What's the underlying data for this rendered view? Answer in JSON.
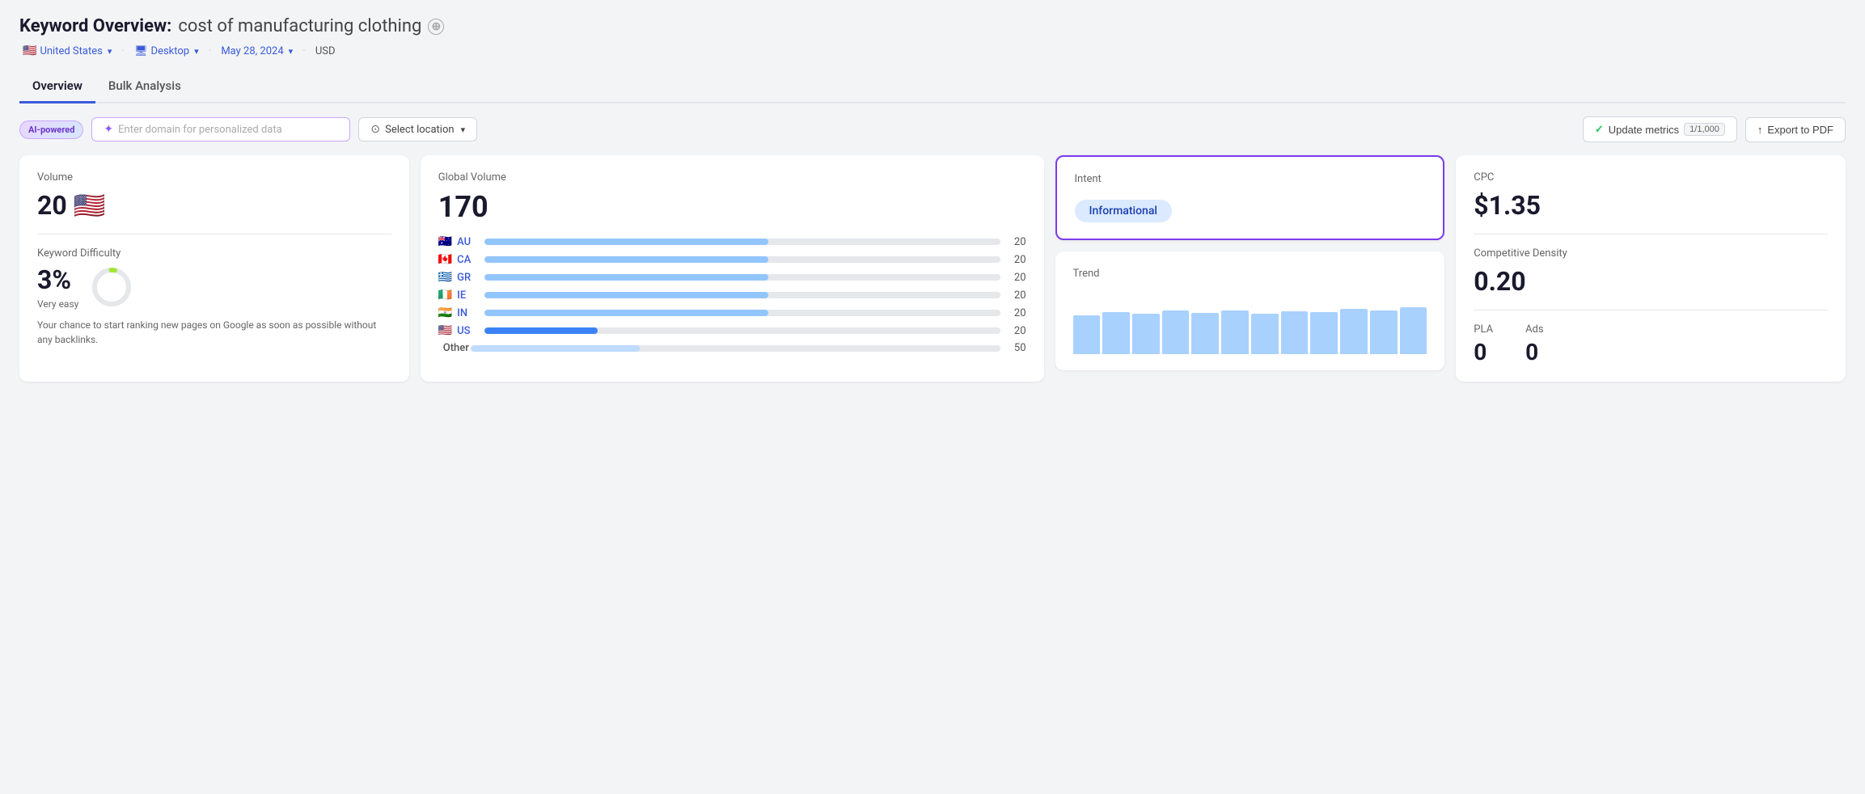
{
  "header": {
    "title_prefix": "Keyword Overview:",
    "keyword": "cost of manufacturing clothing",
    "add_icon": "⊕",
    "meta": {
      "country": "United States",
      "country_flag": "🇺🇸",
      "device": "Desktop",
      "device_icon": "🖥",
      "date": "May 28, 2024",
      "currency": "USD"
    }
  },
  "tabs": [
    {
      "label": "Overview",
      "active": true
    },
    {
      "label": "Bulk Analysis",
      "active": false
    }
  ],
  "toolbar": {
    "ai_badge": "AI-powered",
    "domain_placeholder": "Enter domain for personalized data",
    "location_placeholder": "Select location",
    "update_label": "Update metrics",
    "counter": "1/1,000",
    "export_label": "Export to PDF"
  },
  "cards": {
    "volume": {
      "label": "Volume",
      "value": "20",
      "flag": "🇺🇸",
      "kd_label": "Keyword Difficulty",
      "kd_value": "3%",
      "kd_easy": "Very easy",
      "kd_desc": "Your chance to start ranking new pages on Google as soon as possible without any backlinks.",
      "kd_percent": 3
    },
    "global_volume": {
      "label": "Global Volume",
      "value": "170",
      "countries": [
        {
          "flag": "🇦🇺",
          "code": "AU",
          "num": "20",
          "pct": 55,
          "dark": false
        },
        {
          "flag": "🇨🇦",
          "code": "CA",
          "num": "20",
          "pct": 55,
          "dark": false
        },
        {
          "flag": "🇬🇷",
          "code": "GR",
          "num": "20",
          "pct": 55,
          "dark": false
        },
        {
          "flag": "🇮🇪",
          "code": "IE",
          "num": "20",
          "pct": 55,
          "dark": false
        },
        {
          "flag": "🇮🇳",
          "code": "IN",
          "num": "20",
          "pct": 55,
          "dark": false
        },
        {
          "flag": "🇺🇸",
          "code": "US",
          "num": "20",
          "pct": 22,
          "dark": true
        },
        {
          "flag": "",
          "code": "Other",
          "num": "50",
          "pct": 35,
          "dark": false
        }
      ]
    },
    "intent": {
      "label": "Intent",
      "badge": "Informational",
      "highlighted": true
    },
    "trend": {
      "label": "Trend",
      "bars": [
        60,
        65,
        62,
        68,
        64,
        67,
        63,
        66,
        65,
        70,
        68,
        72
      ]
    },
    "cpc": {
      "label": "CPC",
      "value": "$1.35"
    },
    "competitive": {
      "label": "Competitive Density",
      "value": "0.20"
    },
    "pla": {
      "label": "PLA",
      "value": "0"
    },
    "ads": {
      "label": "Ads",
      "value": "0"
    }
  }
}
